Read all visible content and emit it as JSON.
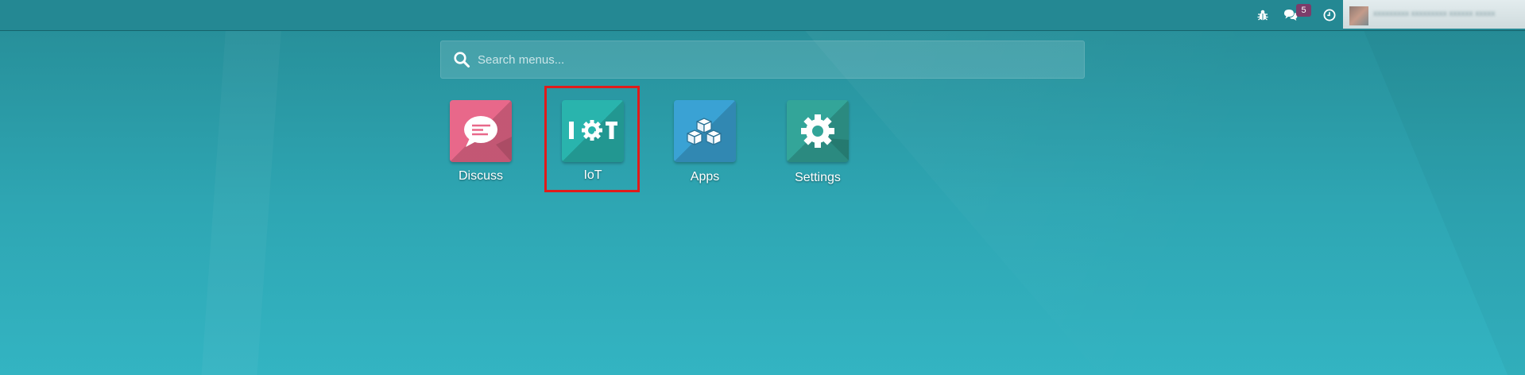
{
  "topbar": {
    "icons": [
      "bug-icon",
      "chat-icon",
      "clock-icon"
    ],
    "messages_badge": "5",
    "user_name": "xxxxxxxxx xxxxxxxxx xxxxxx xxxxx"
  },
  "search": {
    "placeholder": "Search menus...",
    "value": ""
  },
  "apps": [
    {
      "label": "Discuss",
      "icon": "chat-bubble-icon",
      "color": "#e8688a"
    },
    {
      "label": "IoT",
      "icon": "iot-icon",
      "color": "#29b4ad"
    },
    {
      "label": "Apps",
      "icon": "cubes-icon",
      "color": "#3aa2d4"
    },
    {
      "label": "Settings",
      "icon": "gear-icon",
      "color": "#33a599"
    }
  ],
  "selection": {
    "highlighted_app": "IoT",
    "color": "#e01b1b"
  }
}
